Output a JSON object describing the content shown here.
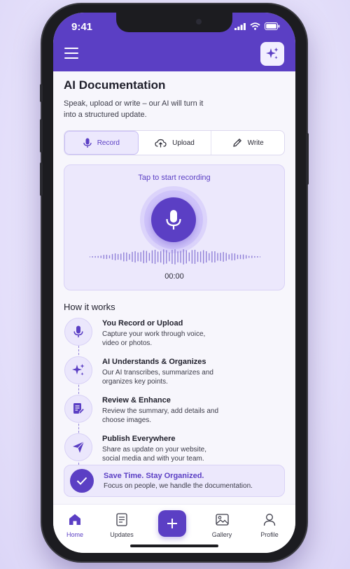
{
  "status_bar": {
    "time": "9:41"
  },
  "header": {
    "menu_icon": "hamburger-icon",
    "action_icon": "sparkle-icon"
  },
  "page": {
    "title": "AI Documentation",
    "subtitle": "Speak, upload or write – our AI will turn it into a structured update."
  },
  "tabs": [
    {
      "label": "Record",
      "icon": "mic-icon",
      "active": true
    },
    {
      "label": "Upload",
      "icon": "cloud-upload-icon",
      "active": false
    },
    {
      "label": "Write",
      "icon": "pencil-icon",
      "active": false
    }
  ],
  "recorder": {
    "prompt": "Tap to start recording",
    "timer": "00:00"
  },
  "how_it_works": {
    "title": "How it works",
    "steps": [
      {
        "title": "You Record or Upload",
        "desc": "Capture your work through voice, video or photos.",
        "icon": "mic-icon"
      },
      {
        "title": "AI Understands & Organizes",
        "desc": "Our AI transcribes, summarizes and organizes key points.",
        "icon": "sparkle-icon"
      },
      {
        "title": "Review & Enhance",
        "desc": "Review the summary, add details and choose images.",
        "icon": "document-edit-icon"
      },
      {
        "title": "Publish Everywhere",
        "desc": "Share as update on your website, social media and with your team.",
        "icon": "send-icon"
      }
    ]
  },
  "banner": {
    "title": "Save Time. Stay Organized.",
    "subtitle": "Focus on people, we handle the documentation."
  },
  "nav": [
    {
      "label": "Home",
      "icon": "home-icon",
      "active": true
    },
    {
      "label": "Updates",
      "icon": "updates-icon",
      "active": false
    },
    {
      "label": "",
      "icon": "plus-icon",
      "active": false
    },
    {
      "label": "Gallery",
      "icon": "gallery-icon",
      "active": false
    },
    {
      "label": "Profile",
      "icon": "profile-icon",
      "active": false
    }
  ],
  "colors": {
    "brand": "#5b3fc4",
    "brand_light": "#ece8fc",
    "background": "#e7e3fb"
  }
}
